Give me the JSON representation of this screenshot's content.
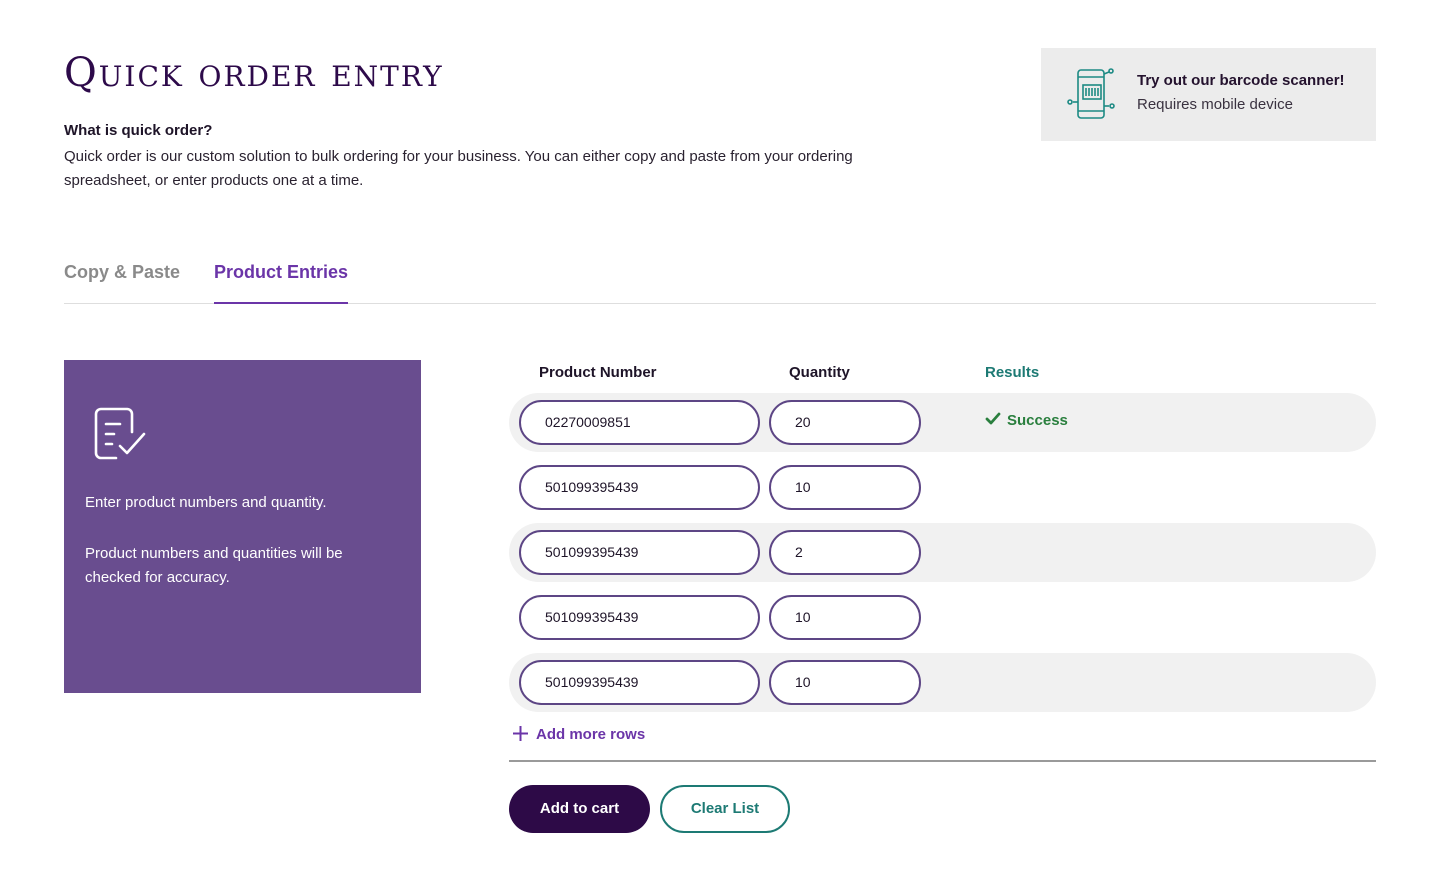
{
  "header": {
    "title": "Quick order entry",
    "intro_heading": "What is quick order?",
    "intro_text": "Quick order is our custom solution to bulk ordering for your business.  You can either copy and paste from your ordering spreadsheet, or enter products one at a time."
  },
  "scanner_banner": {
    "icon": "barcode-phone-icon",
    "title": "Try out our barcode scanner!",
    "subtitle": "Requires mobile device"
  },
  "tabs": [
    {
      "label": "Copy & Paste",
      "active": false
    },
    {
      "label": "Product Entries",
      "active": true
    }
  ],
  "info_panel": {
    "icon": "checklist-document-icon",
    "line1": "Enter product numbers and quantity.",
    "line2": "Product numbers and quantities will be checked for accuracy."
  },
  "table": {
    "headers": {
      "product": "Product Number",
      "quantity": "Quantity",
      "results": "Results"
    },
    "rows": [
      {
        "product": "02270009851",
        "quantity": "20",
        "result": "Success"
      },
      {
        "product": "501099395439",
        "quantity": "10",
        "result": ""
      },
      {
        "product": "501099395439",
        "quantity": "2",
        "result": ""
      },
      {
        "product": "501099395439",
        "quantity": "10",
        "result": ""
      },
      {
        "product": "501099395439",
        "quantity": "10",
        "result": ""
      }
    ]
  },
  "actions": {
    "add_rows": "Add more rows",
    "add_to_cart": "Add to cart",
    "clear_list": "Clear List"
  },
  "colors": {
    "brand_dark": "#2d0a47",
    "brand_purple": "#6b35a8",
    "panel_purple": "#694d8f",
    "teal": "#1d7a74",
    "success_green": "#2a7f3e"
  }
}
